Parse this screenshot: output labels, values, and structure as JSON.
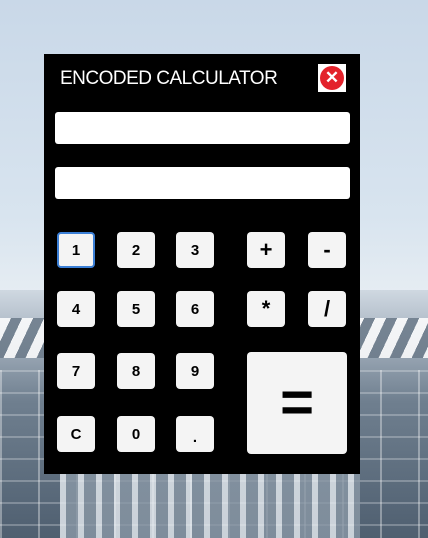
{
  "window": {
    "title": "ENCODED CALCULATOR",
    "close_label": "✕"
  },
  "fields": {
    "input_value": "",
    "output_value": ""
  },
  "keys": {
    "k1": "1",
    "k2": "2",
    "k3": "3",
    "k4": "4",
    "k5": "5",
    "k6": "6",
    "k7": "7",
    "k8": "8",
    "k9": "9",
    "k0": "0",
    "clear": "C",
    "dot": ".",
    "plus": "+",
    "minus": "-",
    "multiply": "*",
    "divide": "/",
    "equals": "="
  },
  "colors": {
    "panel": "#000000",
    "close": "#e3222b",
    "focus": "#3b7fd6"
  }
}
